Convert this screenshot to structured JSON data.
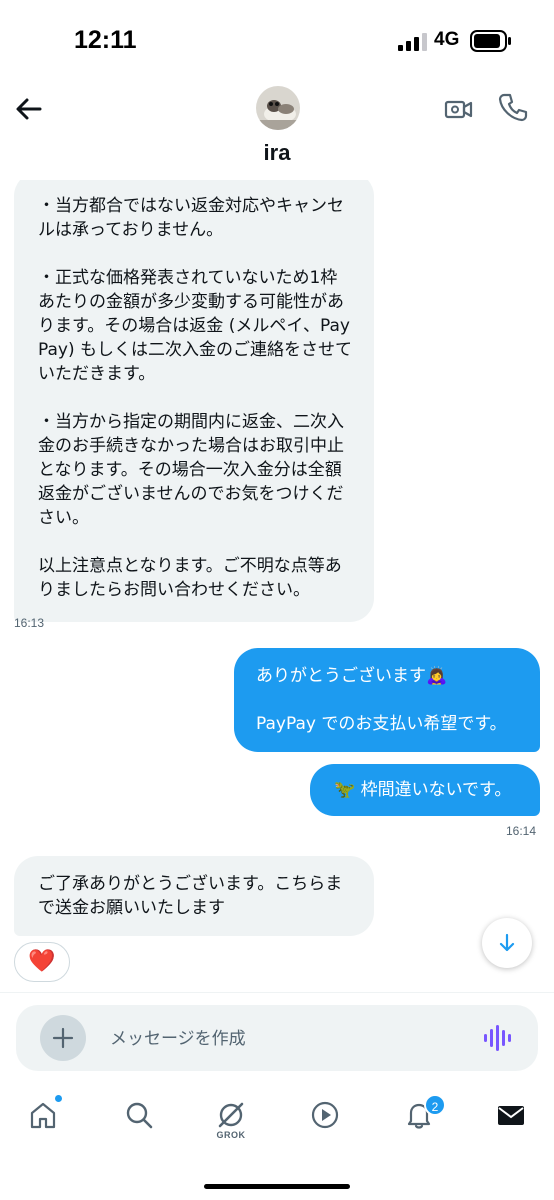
{
  "status_bar": {
    "time": "12:11",
    "network": "4G"
  },
  "header": {
    "contact_name": "ira",
    "icons": [
      "back-arrow-icon",
      "video-call-icon",
      "phone-icon"
    ]
  },
  "messages": [
    {
      "direction": "incoming",
      "text": "・当方都合ではない返金対応やキャンセルは承っておりません。\n\n・正式な価格発表されていないため1枠あたりの金額が多少変動する可能性があります。その場合は返金 (メルペイ、PayPay) もしくは二次入金のご連絡をさせていただきます。\n\n・当方から指定の期間内に返金、二次入金のお手続きなかった場合はお取引中止となります。その場合一次入金分は全額返金がございませんのでお気をつけください。\n\n以上注意点となります。ご不明な点等ありましたらお問い合わせください。",
      "time": "16:13"
    },
    {
      "direction": "outgoing",
      "text": "ありがとうございます🙇‍♀️\n\nPayPay でのお支払い希望です。"
    },
    {
      "direction": "outgoing",
      "text": "🦖 枠間違いないです。",
      "time": "16:14"
    },
    {
      "direction": "incoming",
      "text": "ご了承ありがとうございます。こちらまで送金お願いいたします",
      "reaction": "❤️"
    }
  ],
  "composer": {
    "placeholder": "メッセージを作成"
  },
  "tabbar": {
    "grok_label": "GROK",
    "notification_count": "2"
  },
  "colors": {
    "accent": "#1d9bf0",
    "incoming_bubble": "#eff3f4",
    "secondary_text": "#536471",
    "voice_icon": "#7856ff"
  }
}
